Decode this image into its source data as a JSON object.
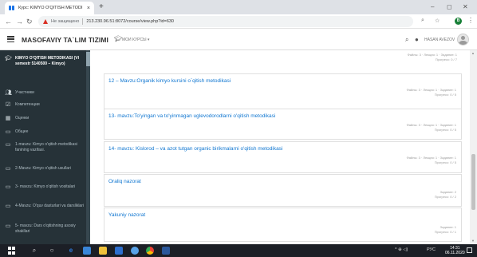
{
  "browser": {
    "tab_title": "Курс: KIMYO O'QITISH METODI",
    "tab_close": "×",
    "new_tab": "+",
    "insecure_label": "Не защищено",
    "url": "213.230.96.51:8072/course/view.php?id=630",
    "minimize": "–",
    "maximize": "◻",
    "close": "✕",
    "profile_initial": "B"
  },
  "header": {
    "site_name": "MASOFAVIY TA`LIM TIZIMI",
    "my_courses_menu": "МОИ КУРСЫ ▾",
    "user_menu": "HASAN AVEZOV"
  },
  "sidebar": {
    "course_title": "KIMYO O'QITISH METODIKASI (VI semestr 5140500 – Kimyo)",
    "items": [
      {
        "label": "Участники",
        "icon": "users-icon"
      },
      {
        "label": "Компетенции",
        "icon": "competencies-icon"
      },
      {
        "label": "Оценки",
        "icon": "grades-icon"
      },
      {
        "label": "Общее",
        "icon": "folder-icon"
      },
      {
        "label": "1-mavzu: Kimyo o'qitish metodikasi fanining vazifasi.",
        "icon": "folder-icon"
      },
      {
        "label": "2-Mavzu: Kimyo o'qitish usullari",
        "icon": "folder-icon"
      },
      {
        "label": "3- mavzu: Kimyo o'qitish vositalari",
        "icon": "folder-icon"
      },
      {
        "label": "4-Mavzu: O'quv dasturlari va darsliklari",
        "icon": "folder-icon"
      },
      {
        "label": "5- mavzu: Dars o'qitishning asosiy shakllari",
        "icon": "folder-icon"
      }
    ]
  },
  "main": {
    "top_meta": [
      "Файлы: 3 · Лекция: 1 · Задание: 1",
      "Прогресс: 0 / 7"
    ],
    "cards": [
      {
        "title": "12 – Mavzu:Organik kimyo kursini o`qitish metodikasi",
        "meta": [
          "Файлы: 3 · Лекция: 1 · Задание: 1",
          "Прогресс: 0 / 5"
        ]
      },
      {
        "title": "13- mavzu:To'yingan va to'yinmagan uglevodorodlarni o'qitish metodikasi",
        "meta": [
          "Файлы: 3 · Лекция: 1 · Задание: 1",
          "Прогресс: 0 / 5"
        ]
      },
      {
        "title": "14- mavzu: Kislorod – va azot tutgan organic birikmalarni o'qitish metodikasi",
        "meta": [
          "Файлы: 3 · Лекция: 1 · Задание: 1",
          "Прогресс: 0 / 5"
        ]
      },
      {
        "title": "Oraliq nazorat",
        "meta": [
          "Задание: 2",
          "Прогресс: 0 / 2"
        ]
      },
      {
        "title": "Yakuniy nazorat",
        "meta": [
          "Задание: 1",
          "Прогресс: 0 / 1"
        ]
      }
    ]
  },
  "taskbar": {
    "keyboard_lang": "РУС",
    "time": "14:31",
    "date": "06.11.2020",
    "tray_symbols": "^ ⊕ ◁)"
  }
}
